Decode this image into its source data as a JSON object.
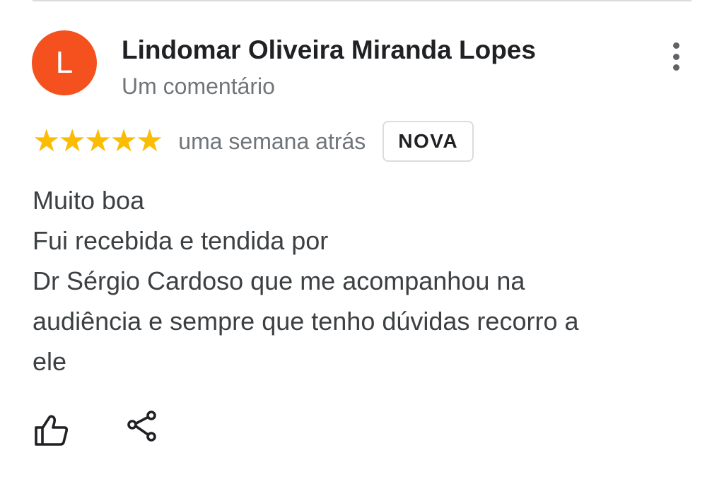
{
  "review": {
    "avatar_letter": "L",
    "avatar_color": "#f4511e",
    "author_name": "Lindomar Oliveira Miranda Lopes",
    "author_meta": "Um comentário",
    "rating": 5,
    "star_color": "#fbbc04",
    "stars": [
      "★",
      "★",
      "★",
      "★",
      "★"
    ],
    "time": "uma semana atrás",
    "badge": "NOVA",
    "text_lines": [
      "Muito boa",
      "Fui recebida e tendida por",
      "Dr Sérgio Cardoso que me acompanhou na",
      "audiência e sempre que tenho dúvidas recorro a",
      "ele"
    ]
  },
  "actions": {
    "like_icon": "thumbs-up-icon",
    "share_icon": "share-icon",
    "more_icon": "more-vert-icon"
  }
}
